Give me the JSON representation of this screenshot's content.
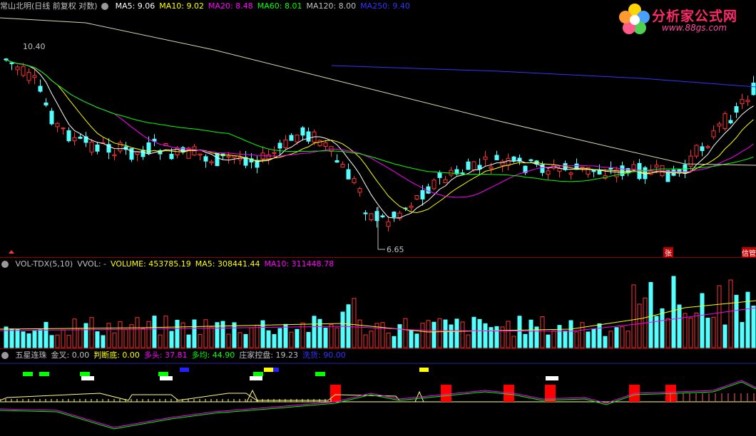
{
  "price_panel": {
    "title": "常山北明(日线 前复权 对数)",
    "ma_items": [
      {
        "label": "MA5: 9.06",
        "color": "#ffffff"
      },
      {
        "label": "MA10: 9.02",
        "color": "#ffff00"
      },
      {
        "label": "MA20: 8.48",
        "color": "#ff00ff"
      },
      {
        "label": "MA60: 8.01",
        "color": "#00ff00"
      },
      {
        "label": "MA120: 8.00",
        "color": "#c0c0c0"
      },
      {
        "label": "MA250: 9.40",
        "color": "#3333ff"
      }
    ],
    "high_label": "10.40",
    "low_label": "6.65",
    "zhang_label": "张",
    "right_tag": "信管"
  },
  "volume_panel": {
    "items": [
      {
        "label": "VOL-TDX(5,10)",
        "color": "#c0c0c0"
      },
      {
        "label": "VVOL: -",
        "color": "#c0c0c0"
      },
      {
        "label": "VOLUME: 453785.19",
        "color": "#ffff00"
      },
      {
        "label": "MA5: 308441.44",
        "color": "#ffff00"
      },
      {
        "label": "MA10: 311448.78",
        "color": "#ff00ff"
      }
    ]
  },
  "indicator_panel": {
    "items": [
      {
        "label": "五星连珠",
        "color": "#c0c0c0"
      },
      {
        "label": "金叉: 0.00",
        "color": "#c0c0c0"
      },
      {
        "label": "判断底: 0.00",
        "color": "#ffff00"
      },
      {
        "label": "多头: 37.81",
        "color": "#ff00ff"
      },
      {
        "label": "多均: 44.90",
        "color": "#00ff00"
      },
      {
        "label": "庄家控盘: 19.23",
        "color": "#c0c0c0"
      },
      {
        "label": "洗货: 90.00",
        "color": "#3333ff"
      }
    ]
  },
  "logo": {
    "title": "分析家公式网",
    "url": "www.88gs.com"
  },
  "colors": {
    "up": "#ff3232",
    "down": "#54ffff",
    "border": "#8b0000"
  }
}
